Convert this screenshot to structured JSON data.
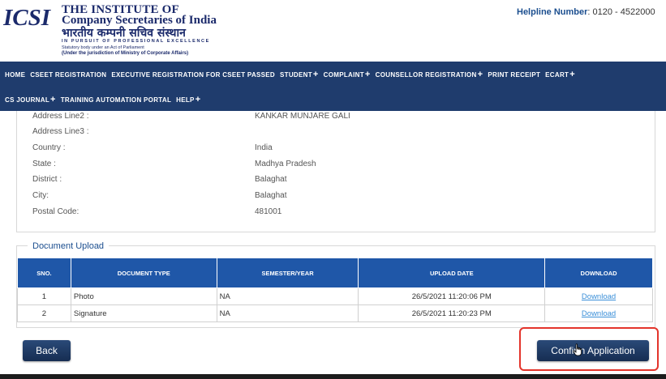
{
  "header": {
    "logo_text": "ICSI",
    "org_line1": "THE INSTITUTE OF",
    "org_line2": "Company Secretaries of India",
    "org_hindi": "भारतीय कम्पनी सचिव संस्थान",
    "tagline": "IN PURSUIT OF PROFESSIONAL EXCELLENCE",
    "sub1": "Statutory body under an Act of Parliament",
    "sub2": "(Under the jurisdiction of Ministry of Corporate Affairs)",
    "helpline_label": "Helpline Number",
    "helpline_value": ": 0120 - 4522000"
  },
  "nav": {
    "row1": [
      {
        "label": "HOME",
        "plus": false
      },
      {
        "label": "CSEET REGISTRATION",
        "plus": false
      },
      {
        "label": "EXECUTIVE REGISTRATION FOR CSEET PASSED",
        "plus": false
      },
      {
        "label": "STUDENT",
        "plus": true
      },
      {
        "label": "COMPLAINT",
        "plus": true
      },
      {
        "label": "COUNSELLOR REGISTRATION",
        "plus": true
      },
      {
        "label": "PRINT RECEIPT",
        "plus": false
      },
      {
        "label": "ECART",
        "plus": true
      }
    ],
    "row2": [
      {
        "label": "CS JOURNAL",
        "plus": true
      },
      {
        "label": "TRAINING AUTOMATION PORTAL",
        "plus": false
      },
      {
        "label": "HELP",
        "plus": true
      }
    ]
  },
  "address": {
    "rows": [
      {
        "label": "Address Line2 :",
        "value": "KANKAR MUNJARE GALI"
      },
      {
        "label": "Address Line3 :",
        "value": ""
      },
      {
        "label": "Country :",
        "value": "India"
      },
      {
        "label": "State :",
        "value": "Madhya Pradesh"
      },
      {
        "label": "District :",
        "value": "Balaghat"
      },
      {
        "label": "City:",
        "value": "Balaghat"
      },
      {
        "label": "Postal Code:",
        "value": "481001"
      }
    ]
  },
  "documents": {
    "legend": "Document Upload",
    "columns": [
      "SNO.",
      "DOCUMENT TYPE",
      "SEMESTER/YEAR",
      "UPLOAD DATE",
      "DOWNLOAD"
    ],
    "rows": [
      {
        "sno": "1",
        "type": "Photo",
        "semester": "NA",
        "date": "26/5/2021 11:20:06 PM",
        "download": "Download"
      },
      {
        "sno": "2",
        "type": "Signature",
        "semester": "NA",
        "date": "26/5/2021 11:20:23 PM",
        "download": "Download"
      }
    ]
  },
  "actions": {
    "back_label": "Back",
    "confirm_label": "Confirm Application"
  },
  "colors": {
    "nav_bg": "#1f3c6d",
    "table_header": "#1f57a8",
    "highlight": "#e3342b",
    "brand_text": "#1b2a6b"
  }
}
